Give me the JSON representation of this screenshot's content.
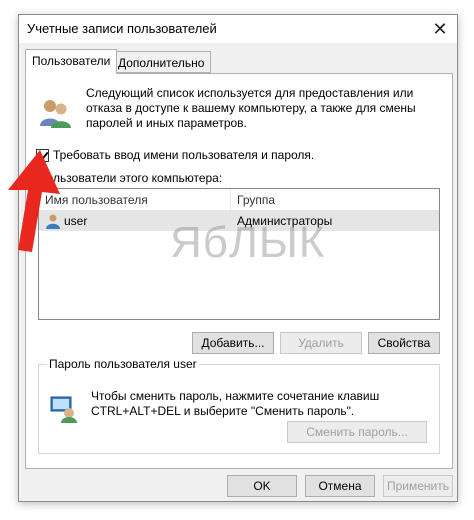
{
  "window": {
    "title": "Учетные записи пользователей",
    "close_glyph": "✕"
  },
  "tabs": [
    {
      "label": "Пользователи",
      "active": true
    },
    {
      "label": "Дополнительно",
      "active": false
    }
  ],
  "intro_text": "Следующий список используется для предоставления или отказа в доступе к вашему компьютеру, а также для смены паролей и иных параметров.",
  "require_login": {
    "label": "Требовать ввод имени пользователя и пароля.",
    "checked": true
  },
  "users_section": {
    "label": "Пользователи этого компьютера:",
    "columns": [
      "Имя пользователя",
      "Группа"
    ],
    "rows": [
      {
        "name": "user",
        "group": "Администраторы"
      }
    ]
  },
  "buttons": {
    "add": "Добавить...",
    "remove": "Удалить",
    "properties": "Свойства"
  },
  "password_group": {
    "title": "Пароль пользователя user",
    "text": "Чтобы сменить пароль, нажмите сочетание клавиш CTRL+ALT+DEL и выберите \"Сменить пароль\".",
    "change_button": "Сменить пароль..."
  },
  "footer": {
    "ok": "OK",
    "cancel": "Отмена",
    "apply": "Применить"
  },
  "watermark": "ЯбЛЫК",
  "colors": {
    "annotation_arrow": "#e8281e",
    "selection_row": "#e5e5e5"
  },
  "icons": [
    "users-icon",
    "user-icon",
    "password-key-icon",
    "close-icon",
    "checkmark-icon"
  ]
}
